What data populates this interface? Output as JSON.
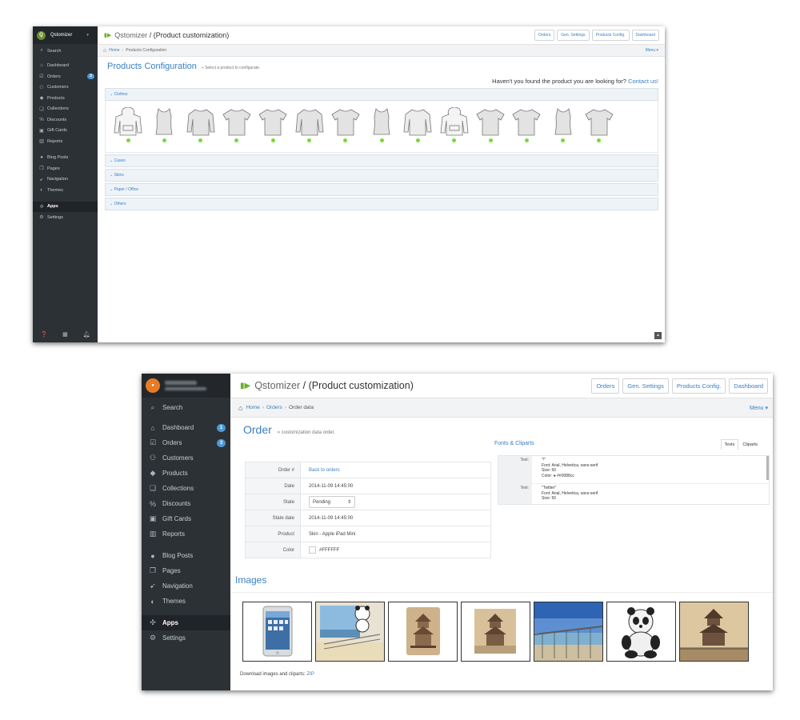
{
  "shot1": {
    "brand": {
      "name": "Qstomizer"
    },
    "sidebar": {
      "search": "Search",
      "items": [
        {
          "label": "Dashboard",
          "icon": "home-icon"
        },
        {
          "label": "Orders",
          "icon": "inbox-icon",
          "badge": "3"
        },
        {
          "label": "Customers",
          "icon": "users-icon"
        },
        {
          "label": "Products",
          "icon": "tag-icon"
        },
        {
          "label": "Collections",
          "icon": "collection-icon"
        },
        {
          "label": "Discounts",
          "icon": "discount-icon"
        },
        {
          "label": "Gift Cards",
          "icon": "gift-icon"
        },
        {
          "label": "Reports",
          "icon": "chart-icon"
        }
      ],
      "items2": [
        {
          "label": "Blog Posts",
          "icon": "blog-icon"
        },
        {
          "label": "Pages",
          "icon": "pages-icon"
        },
        {
          "label": "Navigation",
          "icon": "navigation-icon"
        },
        {
          "label": "Themes",
          "icon": "themes-icon"
        }
      ],
      "items3": [
        {
          "label": "Apps",
          "icon": "puzzle-icon",
          "active": true
        },
        {
          "label": "Settings",
          "icon": "gear-icon"
        }
      ]
    },
    "header": {
      "app_name": "Qstomizer",
      "title_rest": " / (Product customization)"
    },
    "toolbar": {
      "orders": "Orders",
      "gen_settings": "Gen. Settings",
      "products_config": "Products Config.",
      "dashboard": "Dashboard"
    },
    "breadcrumb": {
      "home": "Home",
      "current": "Products Configuration",
      "menu": "Menu ▾"
    },
    "page": {
      "title": "Products Configuration",
      "subtitle": "» Select a product to configurate.",
      "not_found": "Haven't you found the product you are looking for?",
      "contact": "Contact us!"
    },
    "categories": [
      "Clothes",
      "Cases",
      "Skins",
      "Paper / Office",
      "Others"
    ],
    "products": [
      "hoodie",
      "tank-top",
      "long-sleeve",
      "t-shirt",
      "t-shirt",
      "long-sleeve",
      "t-shirt",
      "tank-top",
      "sweatshirt",
      "hoodie",
      "t-shirt",
      "t-shirt",
      "tank-top",
      "t-shirt"
    ]
  },
  "shot2": {
    "sidebar": {
      "search": "Search",
      "items": [
        {
          "label": "Dashboard",
          "icon": "home-icon",
          "badge": "1"
        },
        {
          "label": "Orders",
          "icon": "inbox-icon",
          "badge": "3"
        },
        {
          "label": "Customers",
          "icon": "users-icon"
        },
        {
          "label": "Products",
          "icon": "tag-icon"
        },
        {
          "label": "Collections",
          "icon": "collection-icon"
        },
        {
          "label": "Discounts",
          "icon": "discount-icon"
        },
        {
          "label": "Gift Cards",
          "icon": "gift-icon"
        },
        {
          "label": "Reports",
          "icon": "chart-icon"
        }
      ],
      "items2": [
        {
          "label": "Blog Posts",
          "icon": "blog-icon"
        },
        {
          "label": "Pages",
          "icon": "pages-icon"
        },
        {
          "label": "Navigation",
          "icon": "navigation-icon"
        },
        {
          "label": "Themes",
          "icon": "themes-icon"
        }
      ],
      "items3": [
        {
          "label": "Apps",
          "icon": "puzzle-icon",
          "active": true
        },
        {
          "label": "Settings",
          "icon": "gear-icon"
        }
      ]
    },
    "header": {
      "app_name": "Qstomizer",
      "title_rest": " / (Product customization)"
    },
    "toolbar": {
      "orders": "Orders",
      "gen_settings": "Gen. Settings",
      "products_config": "Products Config.",
      "dashboard": "Dashboard"
    },
    "breadcrumb": {
      "home": "Home",
      "orders": "Orders",
      "current": "Order data",
      "menu": "Menu ▾"
    },
    "order": {
      "title": "Order",
      "subtitle": "» customization data order.",
      "rows": [
        {
          "key": "Order #",
          "value": "Back to orders",
          "link": true
        },
        {
          "key": "Date",
          "value": "2014-11-09 14:45:00"
        },
        {
          "key": "State",
          "value": "Pending",
          "select": true
        },
        {
          "key": "State date",
          "value": "2014-11-09 14:45:00"
        },
        {
          "key": "Product",
          "value": "Skin - Apple iPad Mini"
        },
        {
          "key": "Color",
          "value": "#FFFFFF",
          "swatch": "#FFFFFF"
        }
      ]
    },
    "fonts_cliparts": {
      "title": "Fonts & Cliparts",
      "tabs": [
        "Texts",
        "Cliparts"
      ],
      "entries": [
        {
          "key": "Text:",
          "text": "\"!\"",
          "font": "Font: Arial, Helvetica, sans-serif",
          "size": "Size: 50",
          "color": "Color: ● ##0088cc"
        },
        {
          "key": "Text:",
          "text": "\"Twitter\"",
          "font": "Font: Arial, Helvetica, sans-serif",
          "size": "Size: 50",
          "color": ""
        }
      ]
    },
    "images": {
      "title": "Images",
      "thumbs": [
        "ipad-mini",
        "panda-beach-collage",
        "pavilion-on-beige",
        "pavilion-photo",
        "pier-seascape",
        "panda-plush",
        "pavilion-full"
      ],
      "download_label": "Download images and cliparts:",
      "download_link": "ZIP"
    }
  }
}
